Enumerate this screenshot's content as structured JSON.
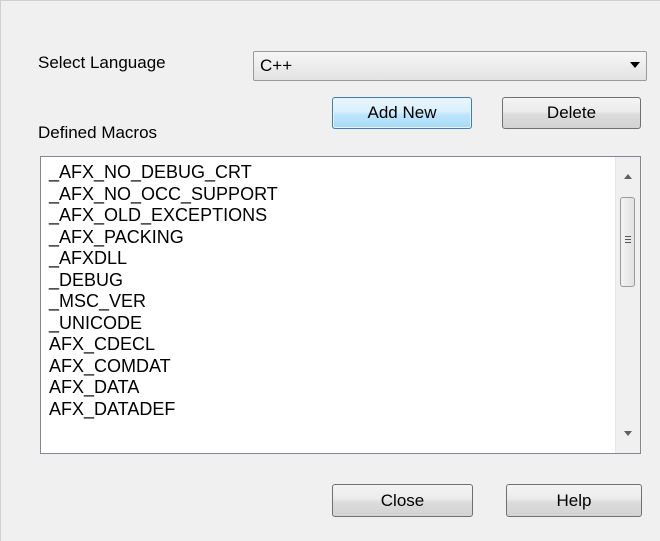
{
  "labels": {
    "select_language": "Select Language",
    "defined_macros": "Defined Macros"
  },
  "language_select": {
    "selected": "C++",
    "icon": "chevron-down-icon"
  },
  "buttons": {
    "add_new": "Add New",
    "delete": "Delete",
    "close": "Close",
    "help": "Help"
  },
  "macros": [
    "_AFX_NO_DEBUG_CRT",
    "_AFX_NO_OCC_SUPPORT",
    "_AFX_OLD_EXCEPTIONS",
    "_AFX_PACKING",
    "_AFXDLL",
    "_DEBUG",
    "_MSC_VER",
    "_UNICODE",
    "AFX_CDECL",
    "AFX_COMDAT",
    "AFX_DATA",
    "AFX_DATADEF"
  ],
  "colors": {
    "dialog_bg": "#f0f0f0",
    "default_button_border": "#3c7fb1"
  }
}
